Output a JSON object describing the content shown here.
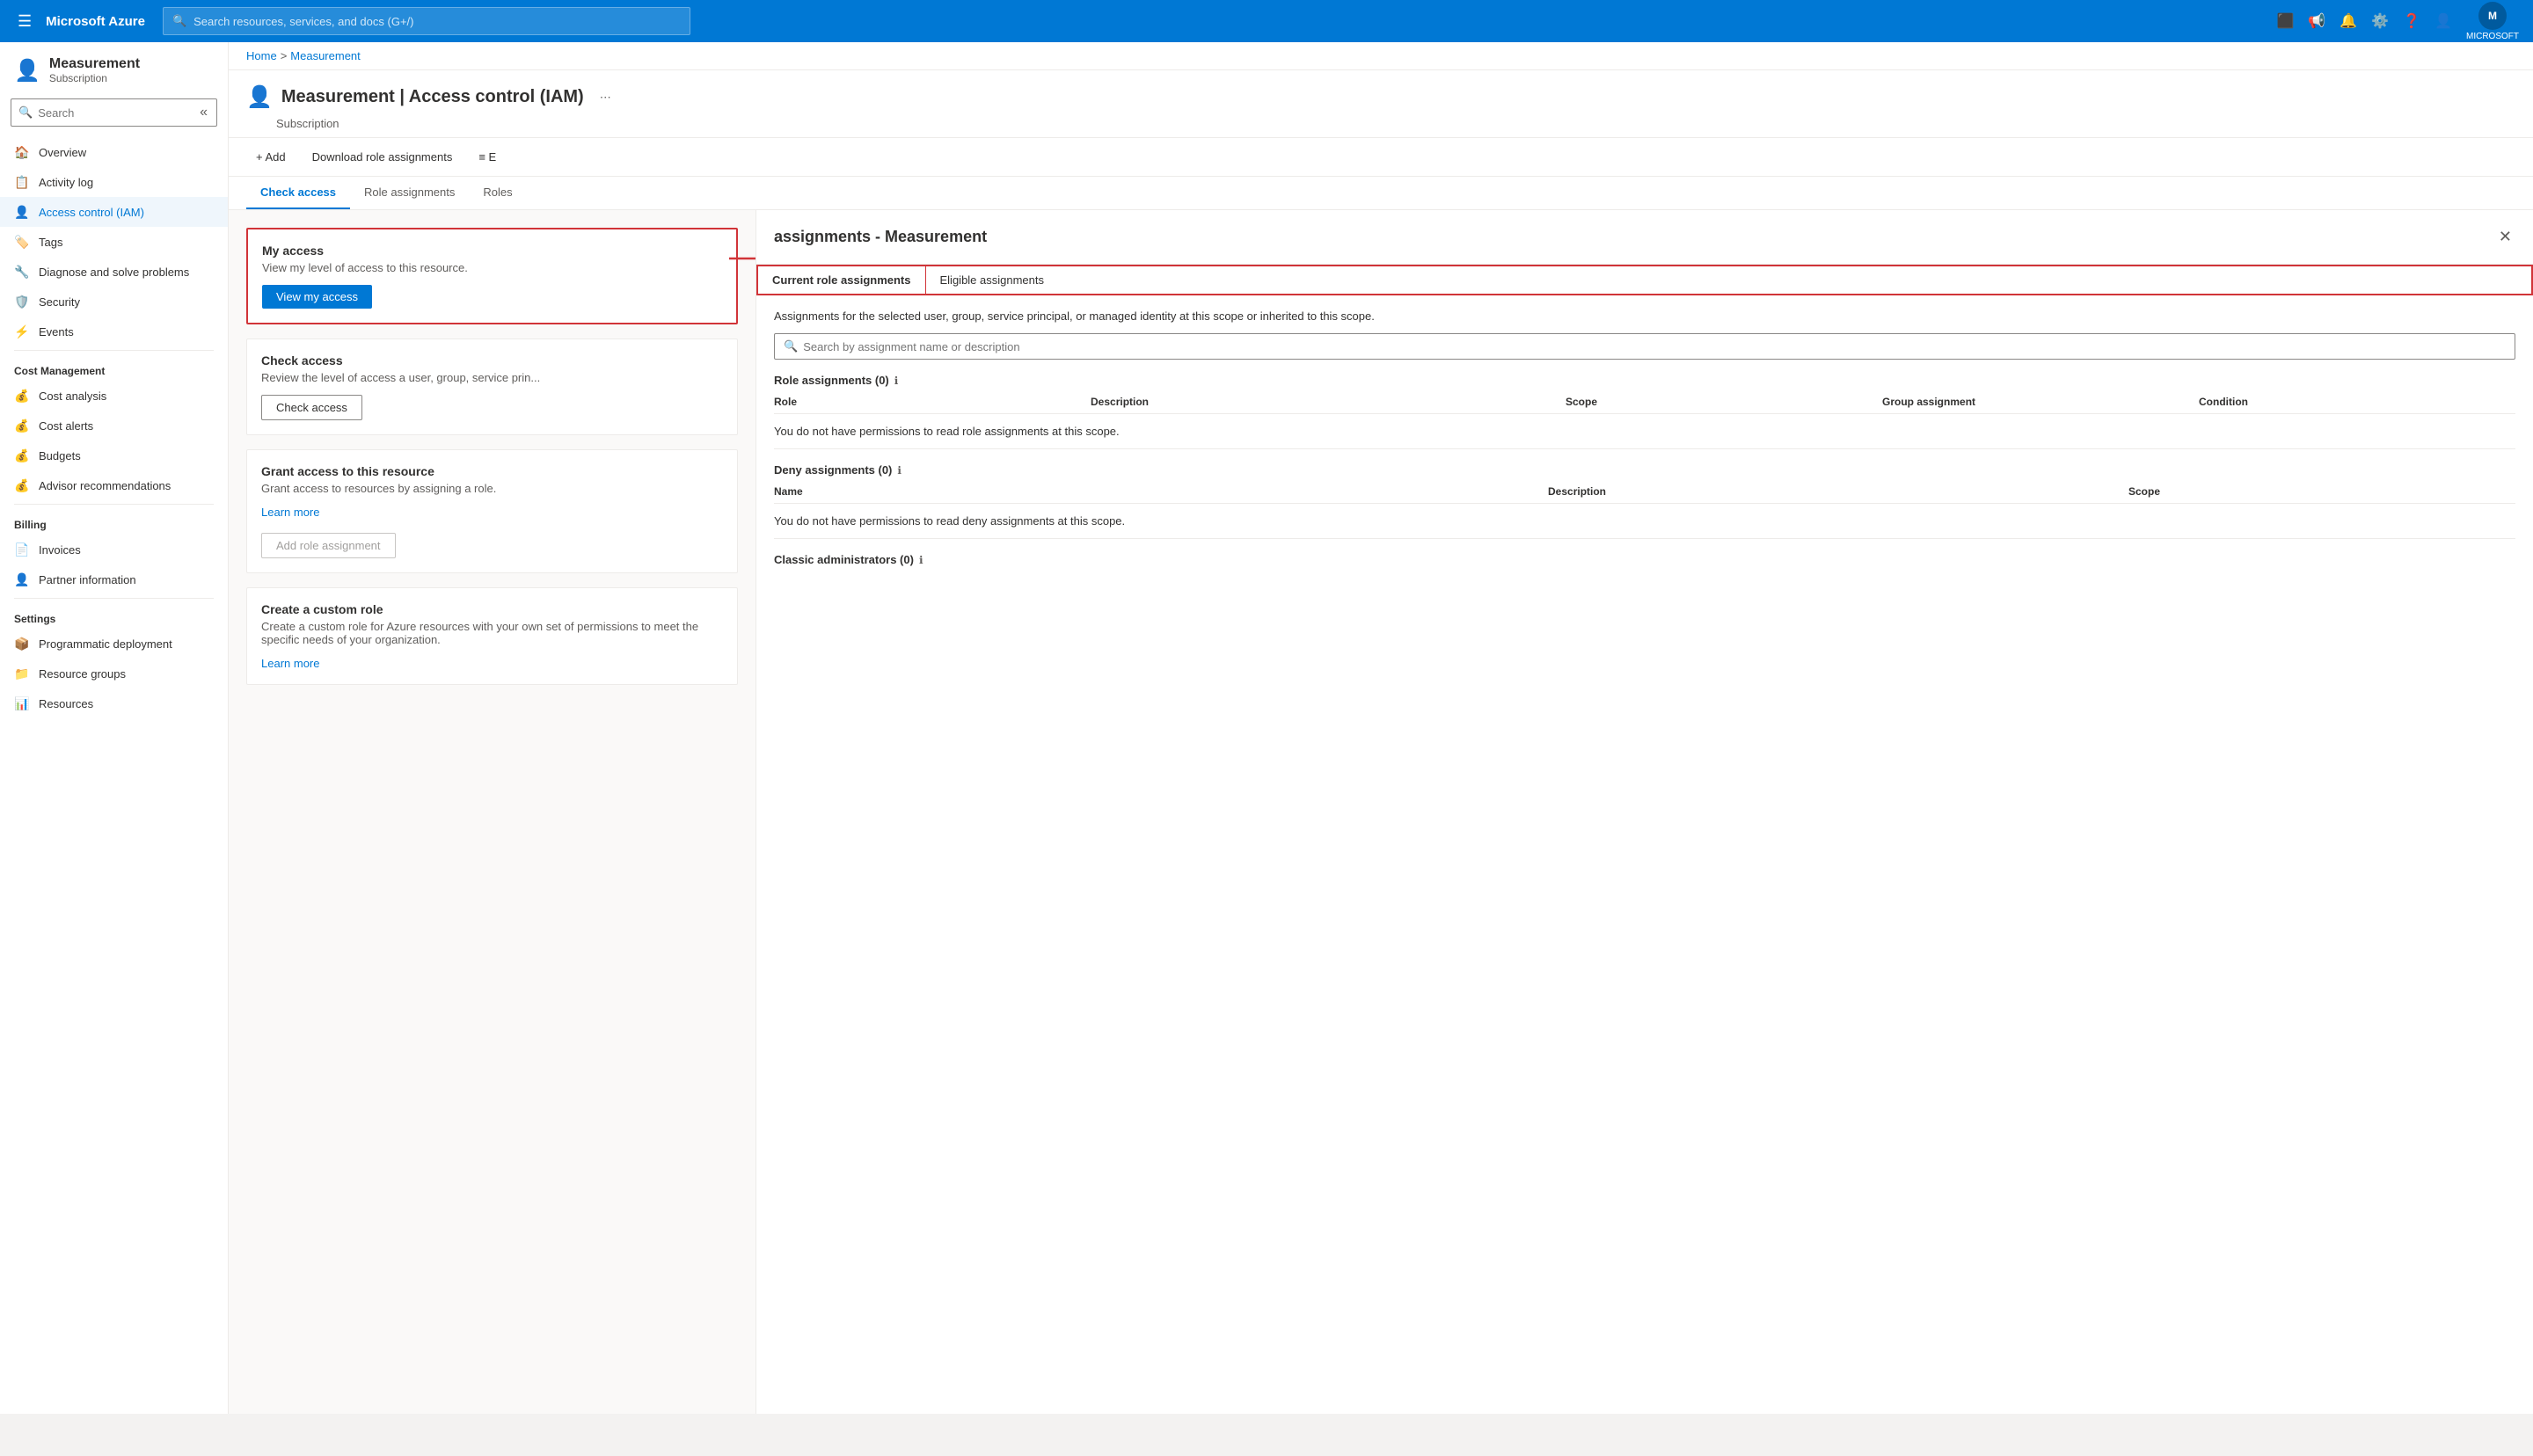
{
  "topNav": {
    "hamburger": "☰",
    "logo": "Microsoft Azure",
    "searchPlaceholder": "Search resources, services, and docs (G+/)",
    "userLabel": "MICROSOFT",
    "icons": [
      "cloud-shell",
      "feedback",
      "bell",
      "settings",
      "help",
      "person"
    ]
  },
  "breadcrumb": {
    "home": "Home",
    "separator": ">",
    "current": "Measurement"
  },
  "page": {
    "title": "Measurement | Access control (IAM)",
    "subtitle": "Subscription"
  },
  "toolbar": {
    "add": "+ Add",
    "download": "Download role assignments",
    "edit": "≡ E"
  },
  "tabs": {
    "items": [
      {
        "label": "Check access",
        "active": true
      },
      {
        "label": "Role assignments",
        "active": false
      },
      {
        "label": "Roles",
        "active": false
      }
    ]
  },
  "sidebar": {
    "searchPlaceholder": "Search",
    "items": [
      {
        "label": "Overview",
        "icon": "🏠",
        "section": ""
      },
      {
        "label": "Activity log",
        "icon": "📋",
        "section": ""
      },
      {
        "label": "Access control (IAM)",
        "icon": "👤",
        "section": "",
        "active": true
      },
      {
        "label": "Tags",
        "icon": "🏷️",
        "section": ""
      },
      {
        "label": "Diagnose and solve problems",
        "icon": "🔧",
        "section": ""
      },
      {
        "label": "Security",
        "icon": "🛡️",
        "section": ""
      },
      {
        "label": "Events",
        "icon": "⚡",
        "section": ""
      }
    ],
    "costManagement": {
      "label": "Cost Management",
      "items": [
        {
          "label": "Cost analysis",
          "icon": "💰"
        },
        {
          "label": "Cost alerts",
          "icon": "💰"
        },
        {
          "label": "Budgets",
          "icon": "💰"
        },
        {
          "label": "Advisor recommendations",
          "icon": "💰"
        }
      ]
    },
    "billing": {
      "label": "Billing",
      "items": [
        {
          "label": "Invoices",
          "icon": "📄"
        },
        {
          "label": "Partner information",
          "icon": "👤"
        }
      ]
    },
    "settings": {
      "label": "Settings",
      "items": [
        {
          "label": "Programmatic deployment",
          "icon": "📦"
        },
        {
          "label": "Resource groups",
          "icon": "📁"
        },
        {
          "label": "Resources",
          "icon": "📊"
        }
      ]
    }
  },
  "checkAccess": {
    "myAccess": {
      "title": "My access",
      "description": "View my level of access to this resource.",
      "buttonLabel": "View my access"
    },
    "checkAccess": {
      "title": "Check access",
      "description": "Review the level of access a user, group, service prin...",
      "buttonLabel": "Check access"
    },
    "grantAccess": {
      "title": "Grant access to this resource",
      "description": "Grant access to resources by assigning a role.",
      "learnMore": "Learn more",
      "buttonLabel": "Add role assignment"
    },
    "customRole": {
      "title": "Create a custom role",
      "description": "Create a custom role for Azure resources with your own set of permissions to meet the specific needs of your organization.",
      "learnMore": "Learn more"
    }
  },
  "rightPanel": {
    "title": "assignments - Measurement",
    "closeBtn": "✕",
    "tabs": [
      {
        "label": "Current role assignments",
        "active": true
      },
      {
        "label": "Eligible assignments",
        "active": false
      }
    ],
    "description": "Assignments for the selected user, group, service principal, or managed identity at this scope or inherited to this scope.",
    "searchPlaceholder": "Search by assignment name or description",
    "roleAssignments": {
      "label": "Role assignments (0)",
      "columns": [
        "Role",
        "Description",
        "Scope",
        "Group assignment",
        "Condition"
      ],
      "emptyMessage": "You do not have permissions to read role assignments at this scope."
    },
    "denyAssignments": {
      "label": "Deny assignments (0)",
      "columns": [
        "Name",
        "Description",
        "Scope"
      ],
      "emptyMessage": "You do not have permissions to read deny assignments at this scope."
    },
    "classicAdmins": {
      "label": "Classic administrators (0)"
    }
  }
}
